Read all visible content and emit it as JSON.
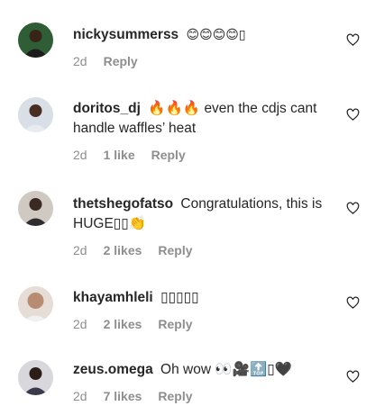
{
  "comments": [
    {
      "username": "nickysummerss",
      "text": "😊😊😊😊▯",
      "time": "2d",
      "likes": "",
      "reply_label": "Reply",
      "avatar_color": "#3b6e3a"
    },
    {
      "username": "doritos_dj",
      "text": "🔥🔥🔥 even the cdjs cant handle waffles’ heat",
      "time": "2d",
      "likes": "1 like",
      "reply_label": "Reply",
      "avatar_color": "#5a3a2a"
    },
    {
      "username": "thetshegofatso",
      "text": "Congratulations, this is HUGE▯▯👏",
      "time": "2d",
      "likes": "2 likes",
      "reply_label": "Reply",
      "avatar_color": "#7a6a5e"
    },
    {
      "username": "khayamhleli",
      "text": "▯▯▯▯▯",
      "time": "2d",
      "likes": "2 likes",
      "reply_label": "Reply",
      "avatar_color": "#c8a48a"
    },
    {
      "username": "zeus.omega",
      "text": "Oh wow 👀🎥🔝▯🖤",
      "time": "2d",
      "likes": "7 likes",
      "reply_label": "Reply",
      "avatar_color": "#3a3a4a"
    }
  ]
}
